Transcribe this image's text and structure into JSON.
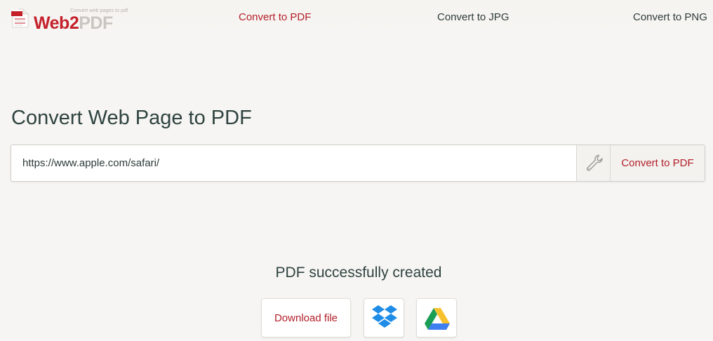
{
  "header": {
    "logo": {
      "tagline": "Convert web pages to pdf",
      "word_part1": "Web2",
      "word_part2": "PDF",
      "doc_badge": "PDF"
    },
    "nav": [
      {
        "label": "Convert to PDF",
        "active": true
      },
      {
        "label": "Convert to JPG",
        "active": false
      },
      {
        "label": "Convert to PNG",
        "active": false
      }
    ]
  },
  "main": {
    "title": "Convert Web Page to PDF",
    "url_value": "https://www.apple.com/safari/",
    "settings_icon": "wrench-icon",
    "convert_label": "Convert to PDF"
  },
  "result": {
    "status": "PDF successfully created",
    "download_label": "Download file",
    "dropbox_icon": "dropbox-icon",
    "gdrive_icon": "google-drive-icon"
  },
  "colors": {
    "accent": "#b3202a",
    "text": "#2f4340",
    "background": "#f6f5f3"
  }
}
